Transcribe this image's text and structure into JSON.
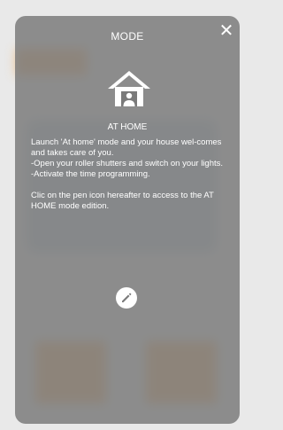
{
  "modal": {
    "title": "MODE",
    "close_icon": "✕",
    "mode_icon": "home-with-person-icon",
    "mode_name": "AT HOME",
    "description": [
      "Launch 'At home' mode and your house wel-comes and takes care of you.",
      "-Open your roller shutters and switch on your lights.",
      "-Activate the time programming."
    ],
    "instruction": "Clic on the pen icon hereafter to access to the AT HOME mode edition.",
    "edit_icon": "pen-icon"
  },
  "colors": {
    "overlay": "#7a7a7a",
    "text": "#ffffff",
    "background_accent": "#eeb26f"
  }
}
